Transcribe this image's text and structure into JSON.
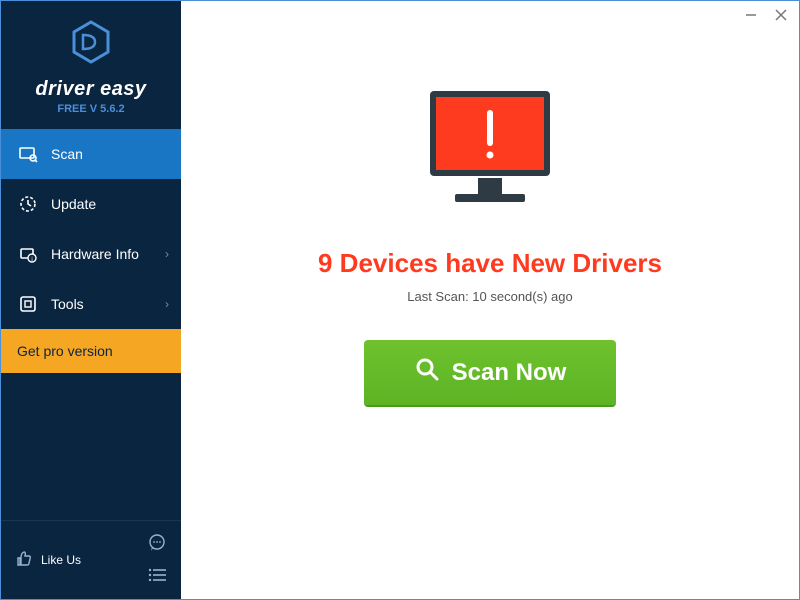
{
  "brand": {
    "name": "driver easy",
    "version": "FREE V 5.6.2"
  },
  "sidebar": {
    "items": [
      {
        "label": "Scan"
      },
      {
        "label": "Update"
      },
      {
        "label": "Hardware Info"
      },
      {
        "label": "Tools"
      }
    ],
    "get_pro_label": "Get pro version",
    "like_label": "Like Us"
  },
  "main": {
    "headline": "9 Devices have New Drivers",
    "last_scan": "Last Scan: 10 second(s) ago",
    "scan_button": "Scan Now"
  },
  "colors": {
    "sidebar_bg": "#0a2540",
    "active": "#1976c4",
    "pro": "#f5a623",
    "alert": "#ff3b1f",
    "scan_btn": "#5cb324"
  }
}
